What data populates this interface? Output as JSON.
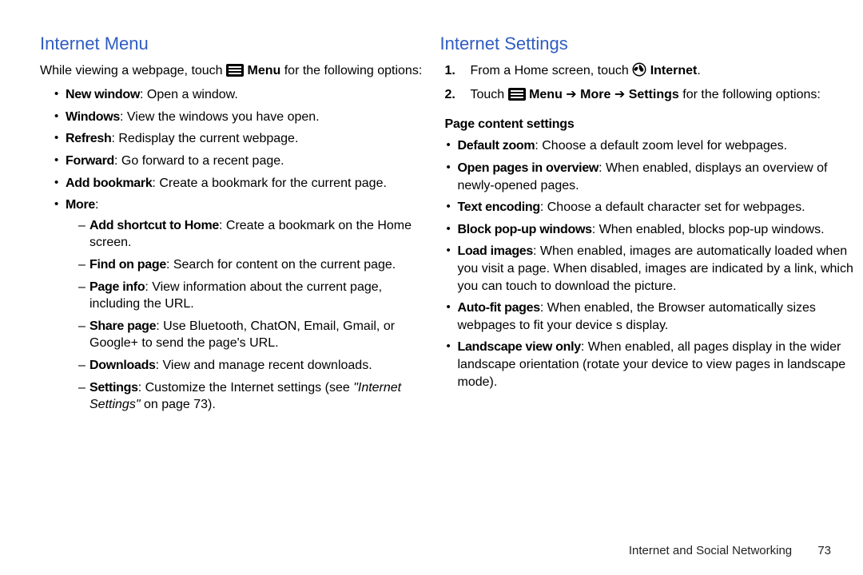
{
  "left": {
    "heading": "Internet Menu",
    "intro_a": "While viewing a webpage, touch ",
    "intro_menu": "Menu",
    "intro_b": " for the following options:",
    "items": [
      {
        "term": "New window",
        "desc": ": Open a window."
      },
      {
        "term": "Windows",
        "desc": ": View the windows you have open."
      },
      {
        "term": "Refresh",
        "desc": ": Redisplay the current webpage."
      },
      {
        "term": "Forward",
        "desc": ": Go forward to a recent page."
      },
      {
        "term": "Add bookmark",
        "desc": ": Create a bookmark for the current page."
      },
      {
        "term": "More",
        "desc": ":"
      }
    ],
    "more": [
      {
        "term": "Add shortcut to Home",
        "desc": ": Create a bookmark on the Home screen."
      },
      {
        "term": "Find on page",
        "desc": ": Search for content on the current page."
      },
      {
        "term": "Page info",
        "desc": ": View information about the current page, including the URL."
      },
      {
        "term": "Share page",
        "desc": ": Use Bluetooth, ChatON, Email, Gmail, or Google+ to send the page's URL."
      },
      {
        "term": "Downloads",
        "desc": ": View and manage recent downloads."
      },
      {
        "term": "Settings",
        "desc_a": ": Customize the Internet settings (see ",
        "link": "\"Internet Settings\"",
        "desc_b": " on page 73)."
      }
    ]
  },
  "right": {
    "heading": "Internet Settings",
    "steps": [
      {
        "num": "1.",
        "pre": "From a Home screen, touch ",
        "post_bold": "Internet",
        "tail": "."
      },
      {
        "num": "2.",
        "pre": "Touch ",
        "menu_label": "Menu",
        "arrow": " ➔ ",
        "more": "More",
        "arrow2": " ➔ ",
        "settings": "Settings",
        "tail": " for the following options:"
      }
    ],
    "subhead": "Page content settings",
    "items": [
      {
        "term": "Default zoom",
        "desc": ": Choose a default zoom level for webpages."
      },
      {
        "term": "Open pages in overview",
        "desc": ": When enabled, displays an overview of newly-opened pages."
      },
      {
        "term": "Text encoding",
        "desc": ": Choose a default character set for webpages."
      },
      {
        "term": "Block pop-up windows",
        "desc": ": When enabled, blocks pop-up windows."
      },
      {
        "term": "Load images",
        "desc": ": When enabled, images are automatically loaded when you visit a page. When disabled, images are indicated by a link, which you can touch to download the picture."
      },
      {
        "term": "Auto-fit pages",
        "desc": ": When enabled, the Browser automatically sizes webpages to fit your device s display."
      },
      {
        "term": "Landscape view only",
        "desc": ": When enabled, all pages display in the wider landscape orientation (rotate your device to view pages in landscape mode)."
      }
    ]
  },
  "footer": {
    "section": "Internet and Social Networking",
    "page": "73"
  }
}
